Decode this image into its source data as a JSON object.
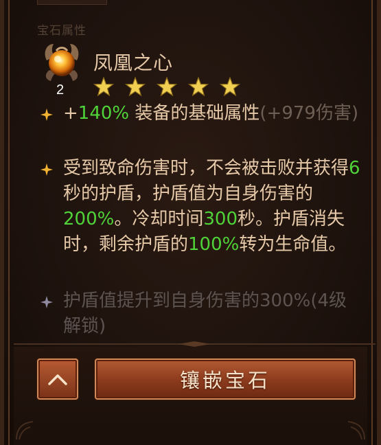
{
  "section_label": "宝石属性",
  "gem": {
    "icon": "phoenix-heart-gem-icon",
    "name": "凤凰之心",
    "level": "2",
    "stars": 5
  },
  "attributes": [
    {
      "state": "active",
      "parts": [
        {
          "t": "+",
          "c": "main"
        },
        {
          "t": "140%",
          "c": "green"
        },
        {
          "t": " 装备的基础属性",
          "c": "main"
        },
        {
          "t": "(+979伤害)",
          "c": "dim"
        }
      ]
    },
    {
      "state": "active",
      "parts": [
        {
          "t": "受到致命伤害时，不会被击败并获得",
          "c": "main"
        },
        {
          "t": "6",
          "c": "green"
        },
        {
          "t": "秒的护盾，护盾值为自身伤害的",
          "c": "main"
        },
        {
          "t": "200%",
          "c": "green"
        },
        {
          "t": "。冷却时间",
          "c": "main"
        },
        {
          "t": "300",
          "c": "green"
        },
        {
          "t": "秒。护盾消失时，剩余护盾的",
          "c": "main"
        },
        {
          "t": "100%",
          "c": "green"
        },
        {
          "t": "转为生命值。",
          "c": "main"
        }
      ]
    },
    {
      "state": "locked",
      "parts": [
        {
          "t": "护盾值提升到自身伤害的300%(4级解锁)",
          "c": "locked"
        }
      ]
    }
  ],
  "buttons": {
    "collapse_icon": "chevron-up-icon",
    "inlay_label": "镶嵌宝石"
  },
  "colors": {
    "text_main": "#e6c9a8",
    "text_green": "#4fd339",
    "text_dim": "#6e5f55",
    "bullet_active": "#f2b232",
    "bullet_locked": "#8f8aa0",
    "button": "#9a4424"
  }
}
